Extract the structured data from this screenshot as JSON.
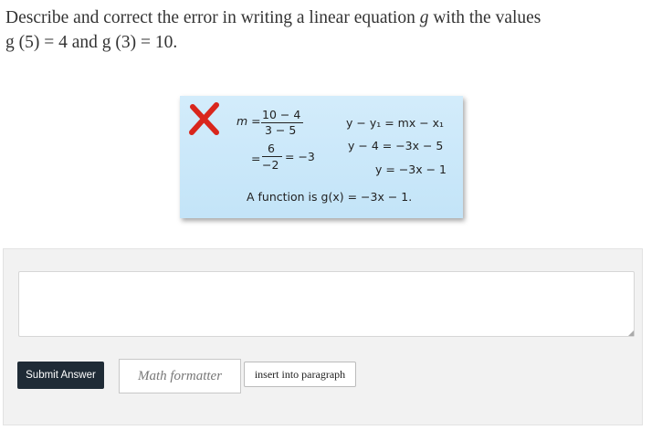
{
  "question": {
    "line1_prefix": "Describe and correct the error in writing a linear equation ",
    "line1_var": "g",
    "line1_suffix": " with the values",
    "line2": "g (5) = 4 and g (3) = 10."
  },
  "work_card": {
    "icon": "red-x-icon",
    "slope_lhs": "m =",
    "slope_num": "10 − 4",
    "slope_den": "3 − 5",
    "slope_eq2_lhs": "=",
    "slope_eq2_num": "6",
    "slope_eq2_den": "−2",
    "slope_eq2_rhs": "= −3",
    "step1": "y − y₁ = mx − x₁",
    "step2": "y − 4 = −3x − 5",
    "step3": "y = −3x − 1",
    "conclusion": "A function is g(x) = −3x − 1.",
    "colors": {
      "background": "#cde9fa",
      "x_mark": "#d9261c"
    }
  },
  "answer": {
    "value": "",
    "placeholder": ""
  },
  "buttons": {
    "submit": "Submit Answer",
    "math_formatter": "Math formatter",
    "insert": "insert into paragraph"
  },
  "colors": {
    "submit_bg": "#1f2b36",
    "panel_bg": "#f2f2f2"
  }
}
